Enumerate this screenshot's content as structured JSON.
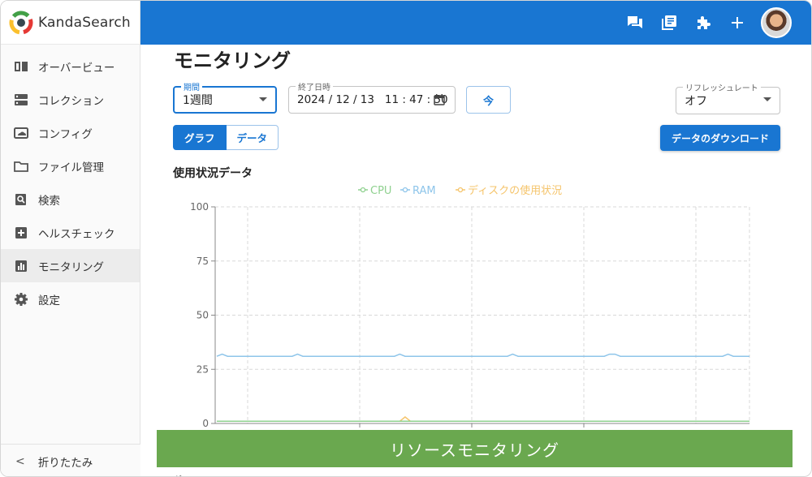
{
  "brand": {
    "name": "KandaSearch"
  },
  "sidebar": {
    "items": [
      {
        "label": "オーバービュー",
        "icon": "book-icon",
        "active": false
      },
      {
        "label": "コレクション",
        "icon": "storage-icon",
        "active": false
      },
      {
        "label": "コンフィグ",
        "icon": "cloud-icon",
        "active": false
      },
      {
        "label": "ファイル管理",
        "icon": "folder-icon",
        "active": false
      },
      {
        "label": "検索",
        "icon": "search-doc-icon",
        "active": false
      },
      {
        "label": "ヘルスチェック",
        "icon": "plus-square-icon",
        "active": false
      },
      {
        "label": "モニタリング",
        "icon": "bar-chart-icon",
        "active": true
      },
      {
        "label": "設定",
        "icon": "gear-icon",
        "active": false
      }
    ],
    "collapse_label": "折りたたみ"
  },
  "topbar": {
    "icons": [
      "forum-icon",
      "library-books-icon",
      "puzzle-icon",
      "add-icon"
    ],
    "accent": "#1976d2"
  },
  "page": {
    "title": "モニタリング",
    "period": {
      "label": "期間",
      "value": "1週間"
    },
    "end_datetime": {
      "label": "終了日時",
      "value": "2024 / 12 / 13   11 : 47 : 50"
    },
    "now_button": "今",
    "refresh": {
      "label": "リフレッシュレート",
      "value": "オフ"
    },
    "view_toggle": {
      "graph": "グラフ",
      "data": "データ",
      "selected": "graph"
    },
    "download_button": "データのダウンロード",
    "section_title": "使用状況データ"
  },
  "chart_data": {
    "type": "line",
    "legend_position": "top",
    "ylim": [
      0,
      100
    ],
    "yticks": [
      0,
      25,
      50,
      75,
      100
    ],
    "grid": true,
    "series": [
      {
        "name": "CPU",
        "color": "#8fd18f",
        "values": [
          1,
          1,
          1,
          1,
          1,
          1,
          1,
          1,
          1,
          1,
          1,
          1,
          1,
          1,
          1,
          1,
          1,
          1,
          1,
          1,
          1,
          1,
          1,
          1,
          1,
          1,
          1,
          1,
          1,
          1,
          1,
          1,
          1,
          1,
          1,
          1,
          1,
          1,
          1,
          1,
          1,
          1,
          1,
          1,
          1,
          1,
          1,
          1,
          1,
          1,
          1,
          1,
          1,
          1,
          1,
          1,
          1,
          1,
          1,
          1,
          1,
          1,
          1,
          1,
          1,
          1,
          1,
          1,
          1,
          1,
          1,
          1,
          1,
          1,
          1,
          1,
          1,
          1,
          1,
          1,
          1,
          1,
          1,
          1,
          1,
          1,
          1,
          1,
          1,
          1,
          1,
          1,
          1,
          1,
          1,
          1,
          1,
          1,
          1,
          1
        ]
      },
      {
        "name": "RAM",
        "color": "#8ec5ea",
        "values": [
          31,
          32,
          31,
          31,
          31,
          31,
          31,
          31,
          31,
          31,
          31,
          31,
          31,
          31,
          31,
          32,
          31,
          31,
          31,
          31,
          31,
          31,
          31,
          31,
          31,
          31,
          31,
          31,
          31,
          31,
          31,
          31,
          31,
          31,
          32,
          31,
          31,
          31,
          31,
          31,
          31,
          31,
          31,
          31,
          31,
          31,
          31,
          31,
          31,
          31,
          31,
          31,
          31,
          31,
          31,
          32,
          31,
          31,
          31,
          31,
          31,
          31,
          31,
          31,
          31,
          31,
          31,
          31,
          31,
          31,
          31,
          31,
          31,
          32,
          32,
          31,
          31,
          31,
          31,
          31,
          31,
          31,
          31,
          31,
          31,
          31,
          31,
          31,
          31,
          31,
          31,
          31,
          31,
          31,
          31,
          32,
          31,
          31,
          31,
          31
        ]
      },
      {
        "name": "ディスクの使用状況",
        "color": "#f5c46b",
        "values": [
          1,
          1,
          1,
          1,
          1,
          1,
          1,
          1,
          1,
          1,
          1,
          1,
          1,
          1,
          1,
          1,
          1,
          1,
          1,
          1,
          1,
          1,
          1,
          1,
          1,
          1,
          1,
          1,
          1,
          1,
          1,
          1,
          1,
          1,
          1,
          3,
          1,
          1,
          1,
          1,
          1,
          1,
          1,
          1,
          1,
          1,
          1,
          1,
          1,
          1,
          1,
          1,
          1,
          1,
          1,
          1,
          1,
          1,
          1,
          1,
          1,
          1,
          1,
          1,
          1,
          1,
          1,
          1,
          1,
          1,
          1,
          1,
          1,
          1,
          1,
          1,
          1,
          1,
          1,
          1,
          1,
          1,
          1,
          1,
          1,
          1,
          1,
          1,
          1,
          1,
          1,
          1,
          1,
          1,
          1,
          1,
          1,
          1,
          1,
          1
        ]
      }
    ]
  },
  "banner": {
    "text": "リソースモニタリング"
  },
  "peek_text": "グ"
}
